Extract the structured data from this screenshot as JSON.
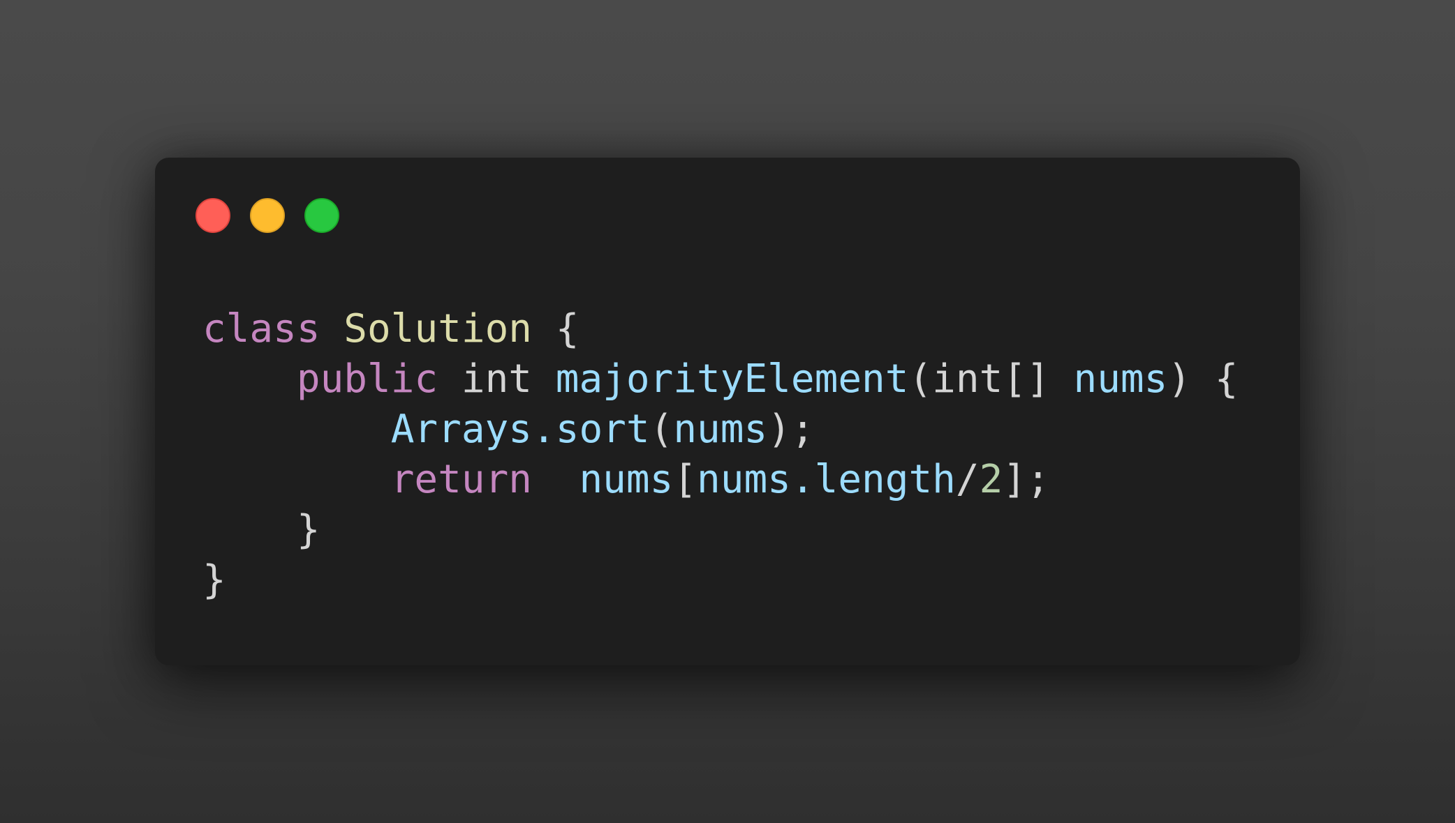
{
  "window": {
    "controls": [
      "close",
      "minimize",
      "zoom"
    ]
  },
  "colors": {
    "background": "#484848",
    "window_bg": "#1e1e1e",
    "keyword": "#c586c0",
    "class_name": "#dcdcaa",
    "identifier": "#9cdcfe",
    "plain": "#d4d4d4",
    "number": "#b5cea8",
    "close": "#ff5f57",
    "minimize": "#febc2e",
    "zoom": "#28c840"
  },
  "code": {
    "language": "java",
    "lines": [
      [
        "class",
        " ",
        "Solution",
        " {"
      ],
      [
        "    ",
        "public",
        " int ",
        "majorityElement",
        "(int[] ",
        "nums",
        ") {"
      ],
      [
        "        ",
        "Arrays.sort",
        "(",
        "nums",
        ");"
      ],
      [
        "        ",
        "return",
        "  ",
        "nums",
        "[",
        "nums.length",
        "/",
        "2",
        "];"
      ],
      [
        "    }"
      ],
      [
        "}"
      ]
    ]
  }
}
